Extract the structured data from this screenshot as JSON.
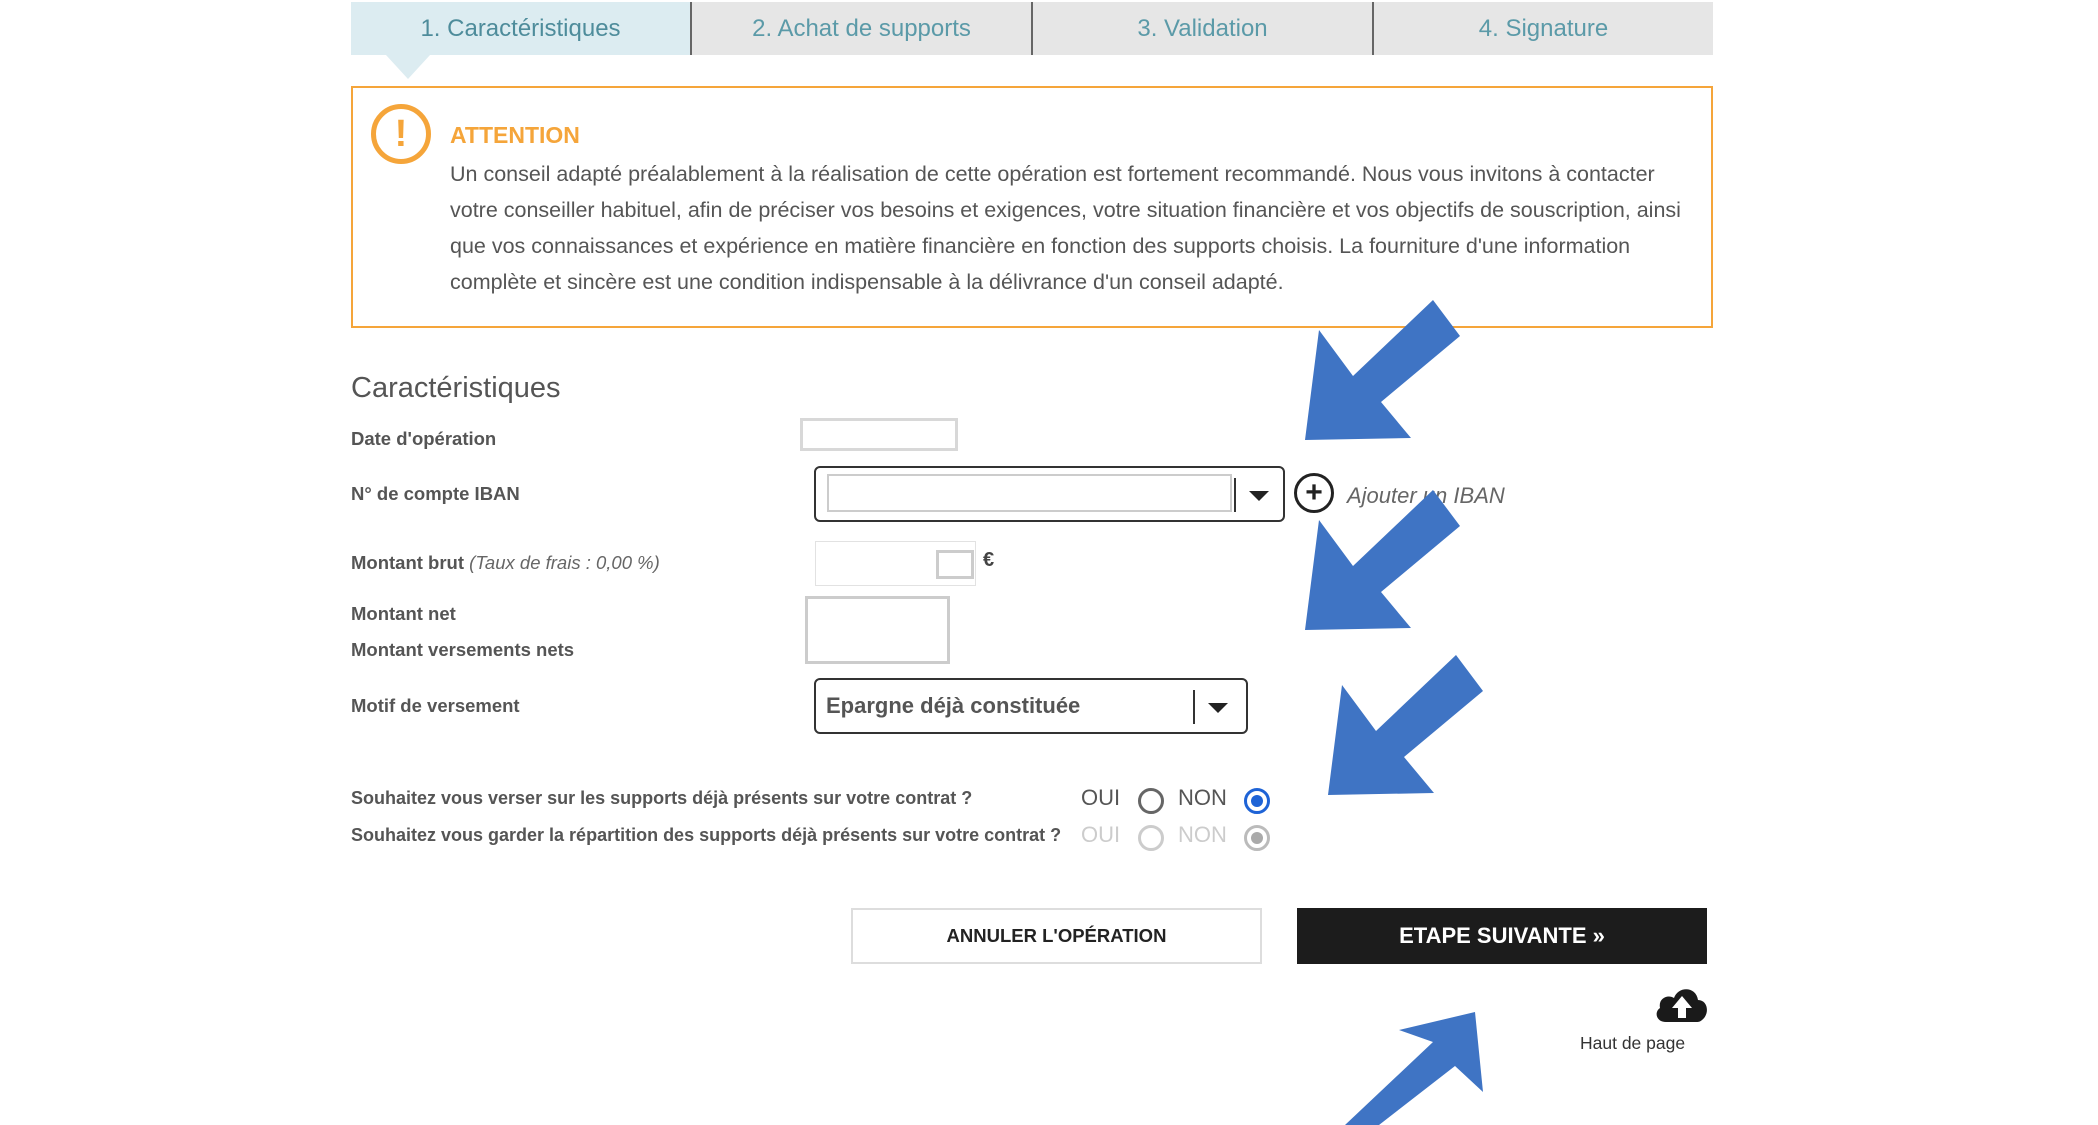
{
  "steps": [
    {
      "label": "1. Caractéristiques",
      "active": true
    },
    {
      "label": "2. Achat de supports",
      "active": false
    },
    {
      "label": "3. Validation",
      "active": false
    },
    {
      "label": "4. Signature",
      "active": false
    }
  ],
  "attention": {
    "icon": "exclamation-circle-icon",
    "title": "ATTENTION",
    "text": "Un conseil adapté préalablement à la réalisation de cette opération est fortement recommandé. Nous vous invitons à contacter votre conseiller habituel, afin de préciser vos besoins et exigences, votre situation financière et vos objectifs de souscription, ainsi que vos connaissances et expérience en matière financière en fonction des supports choisis. La fourniture d'une information complète et sincère est une condition indispensable à la délivrance d'un conseil adapté."
  },
  "form": {
    "section_title": "Caractéristiques",
    "date_label": "Date d'opération",
    "date_value": "",
    "iban_label": "N° de compte IBAN",
    "iban_value": "",
    "add_iban_label": "Ajouter un IBAN",
    "amount_label": "Montant brut",
    "amount_fee_note": "(Taux de frais : 0,00 %)",
    "amount_value": "",
    "currency": "€",
    "net_label": "Montant net",
    "net_payments_label": "Montant versements nets",
    "motif_label": "Motif de versement",
    "motif_value": "Epargne déjà constituée"
  },
  "questions": [
    {
      "text": "Souhaitez vous verser sur les supports déjà présents sur votre contrat ?",
      "yes": "OUI",
      "no": "NON",
      "selected": "NON",
      "disabled": false
    },
    {
      "text": "Souhaitez vous garder la répartition des supports déjà présents sur votre contrat ?",
      "yes": "OUI",
      "no": "NON",
      "selected": "NON",
      "disabled": true
    }
  ],
  "buttons": {
    "cancel": "ANNULER L'OPÉRATION",
    "next": "ETAPE SUIVANTE »"
  },
  "back_to_top": {
    "icon": "cloud-upload-icon",
    "label": "Haut de page"
  },
  "colors": {
    "accent_orange": "#f5a53a",
    "step_text": "#5b9aa8",
    "active_step_bg": "#dcecf1",
    "radio_selected": "#1e63d6",
    "annotation_arrow": "#3f74c4",
    "primary_button_bg": "#1c1c1c"
  }
}
